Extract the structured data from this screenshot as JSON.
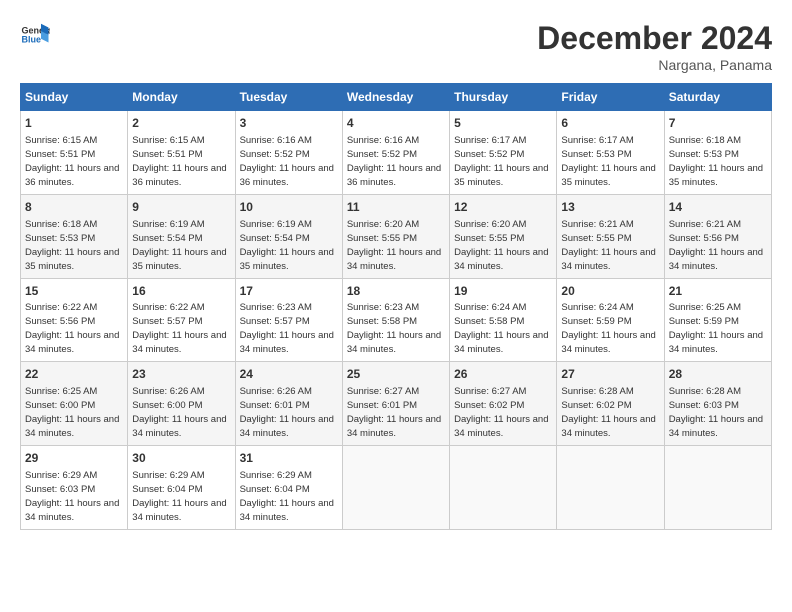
{
  "logo": {
    "line1": "General",
    "line2": "Blue"
  },
  "title": "December 2024",
  "subtitle": "Nargana, Panama",
  "days_of_week": [
    "Sunday",
    "Monday",
    "Tuesday",
    "Wednesday",
    "Thursday",
    "Friday",
    "Saturday"
  ],
  "weeks": [
    [
      {
        "day": "1",
        "sunrise": "6:15 AM",
        "sunset": "5:51 PM",
        "daylight": "11 hours and 36 minutes."
      },
      {
        "day": "2",
        "sunrise": "6:15 AM",
        "sunset": "5:51 PM",
        "daylight": "11 hours and 36 minutes."
      },
      {
        "day": "3",
        "sunrise": "6:16 AM",
        "sunset": "5:52 PM",
        "daylight": "11 hours and 36 minutes."
      },
      {
        "day": "4",
        "sunrise": "6:16 AM",
        "sunset": "5:52 PM",
        "daylight": "11 hours and 36 minutes."
      },
      {
        "day": "5",
        "sunrise": "6:17 AM",
        "sunset": "5:52 PM",
        "daylight": "11 hours and 35 minutes."
      },
      {
        "day": "6",
        "sunrise": "6:17 AM",
        "sunset": "5:53 PM",
        "daylight": "11 hours and 35 minutes."
      },
      {
        "day": "7",
        "sunrise": "6:18 AM",
        "sunset": "5:53 PM",
        "daylight": "11 hours and 35 minutes."
      }
    ],
    [
      {
        "day": "8",
        "sunrise": "6:18 AM",
        "sunset": "5:53 PM",
        "daylight": "11 hours and 35 minutes."
      },
      {
        "day": "9",
        "sunrise": "6:19 AM",
        "sunset": "5:54 PM",
        "daylight": "11 hours and 35 minutes."
      },
      {
        "day": "10",
        "sunrise": "6:19 AM",
        "sunset": "5:54 PM",
        "daylight": "11 hours and 35 minutes."
      },
      {
        "day": "11",
        "sunrise": "6:20 AM",
        "sunset": "5:55 PM",
        "daylight": "11 hours and 34 minutes."
      },
      {
        "day": "12",
        "sunrise": "6:20 AM",
        "sunset": "5:55 PM",
        "daylight": "11 hours and 34 minutes."
      },
      {
        "day": "13",
        "sunrise": "6:21 AM",
        "sunset": "5:55 PM",
        "daylight": "11 hours and 34 minutes."
      },
      {
        "day": "14",
        "sunrise": "6:21 AM",
        "sunset": "5:56 PM",
        "daylight": "11 hours and 34 minutes."
      }
    ],
    [
      {
        "day": "15",
        "sunrise": "6:22 AM",
        "sunset": "5:56 PM",
        "daylight": "11 hours and 34 minutes."
      },
      {
        "day": "16",
        "sunrise": "6:22 AM",
        "sunset": "5:57 PM",
        "daylight": "11 hours and 34 minutes."
      },
      {
        "day": "17",
        "sunrise": "6:23 AM",
        "sunset": "5:57 PM",
        "daylight": "11 hours and 34 minutes."
      },
      {
        "day": "18",
        "sunrise": "6:23 AM",
        "sunset": "5:58 PM",
        "daylight": "11 hours and 34 minutes."
      },
      {
        "day": "19",
        "sunrise": "6:24 AM",
        "sunset": "5:58 PM",
        "daylight": "11 hours and 34 minutes."
      },
      {
        "day": "20",
        "sunrise": "6:24 AM",
        "sunset": "5:59 PM",
        "daylight": "11 hours and 34 minutes."
      },
      {
        "day": "21",
        "sunrise": "6:25 AM",
        "sunset": "5:59 PM",
        "daylight": "11 hours and 34 minutes."
      }
    ],
    [
      {
        "day": "22",
        "sunrise": "6:25 AM",
        "sunset": "6:00 PM",
        "daylight": "11 hours and 34 minutes."
      },
      {
        "day": "23",
        "sunrise": "6:26 AM",
        "sunset": "6:00 PM",
        "daylight": "11 hours and 34 minutes."
      },
      {
        "day": "24",
        "sunrise": "6:26 AM",
        "sunset": "6:01 PM",
        "daylight": "11 hours and 34 minutes."
      },
      {
        "day": "25",
        "sunrise": "6:27 AM",
        "sunset": "6:01 PM",
        "daylight": "11 hours and 34 minutes."
      },
      {
        "day": "26",
        "sunrise": "6:27 AM",
        "sunset": "6:02 PM",
        "daylight": "11 hours and 34 minutes."
      },
      {
        "day": "27",
        "sunrise": "6:28 AM",
        "sunset": "6:02 PM",
        "daylight": "11 hours and 34 minutes."
      },
      {
        "day": "28",
        "sunrise": "6:28 AM",
        "sunset": "6:03 PM",
        "daylight": "11 hours and 34 minutes."
      }
    ],
    [
      {
        "day": "29",
        "sunrise": "6:29 AM",
        "sunset": "6:03 PM",
        "daylight": "11 hours and 34 minutes."
      },
      {
        "day": "30",
        "sunrise": "6:29 AM",
        "sunset": "6:04 PM",
        "daylight": "11 hours and 34 minutes."
      },
      {
        "day": "31",
        "sunrise": "6:29 AM",
        "sunset": "6:04 PM",
        "daylight": "11 hours and 34 minutes."
      },
      null,
      null,
      null,
      null
    ]
  ],
  "labels": {
    "sunrise": "Sunrise: ",
    "sunset": "Sunset: ",
    "daylight": "Daylight: "
  }
}
